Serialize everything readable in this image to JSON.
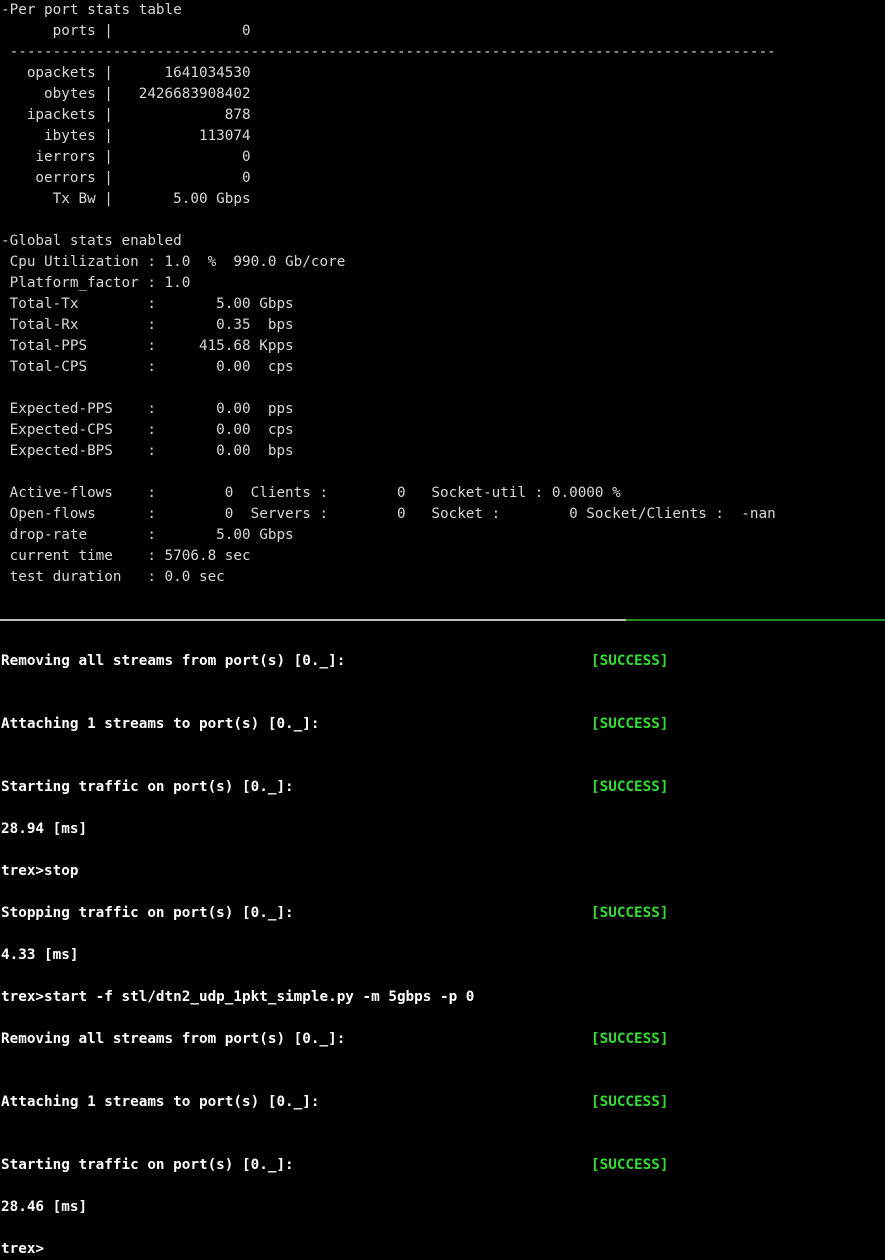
{
  "stats_lines": [
    "-Per port stats table",
    "      ports |               0",
    " -----------------------------------------------------------------------------------------",
    "   opackets |      1641034530",
    "     obytes |   2426683908402",
    "   ipackets |             878",
    "     ibytes |          113074",
    "    ierrors |               0",
    "    oerrors |               0",
    "      Tx Bw |       5.00 Gbps",
    "",
    "-Global stats enabled",
    " Cpu Utilization : 1.0  %  990.0 Gb/core",
    " Platform_factor : 1.0",
    " Total-Tx        :       5.00 Gbps",
    " Total-Rx        :       0.35  bps",
    " Total-PPS       :     415.68 Kpps",
    " Total-CPS       :       0.00  cps",
    "",
    " Expected-PPS    :       0.00  pps",
    " Expected-CPS    :       0.00  cps",
    " Expected-BPS    :       0.00  bps",
    "",
    " Active-flows    :        0  Clients :        0   Socket-util : 0.0000 %",
    " Open-flows      :        0  Servers :        0   Socket :        0 Socket/Clients :  -nan",
    " drop-rate       :       5.00 Gbps",
    " current time    : 5706.8 sec",
    " test duration   : 0.0 sec"
  ],
  "log": {
    "line1": "Removing all streams from port(s) [0._]:",
    "line2": "Attaching 1 streams to port(s) [0._]:",
    "line3": "Starting traffic on port(s) [0._]:",
    "line4": "28.94 [ms]",
    "line5": "trex>stop",
    "line6": "Stopping traffic on port(s) [0._]:",
    "line7": "4.33 [ms]",
    "line8": "trex>start -f stl/dtn2_udp_1pkt_simple.py -m 5gbps -p 0",
    "line9": "Removing all streams from port(s) [0._]:",
    "line10": "Attaching 1 streams to port(s) [0._]:",
    "line11": "Starting traffic on port(s) [0._]:",
    "line12": "28.46 [ms]",
    "prompt": "trex>",
    "success": "[SUCCESS]"
  },
  "colors": {
    "background": "#000000",
    "text": "#d8d8d8",
    "bold_text": "#ffffff",
    "success": "#33dd33",
    "divider_left": "#bcbcbc",
    "divider_right": "#1e8f1e"
  }
}
